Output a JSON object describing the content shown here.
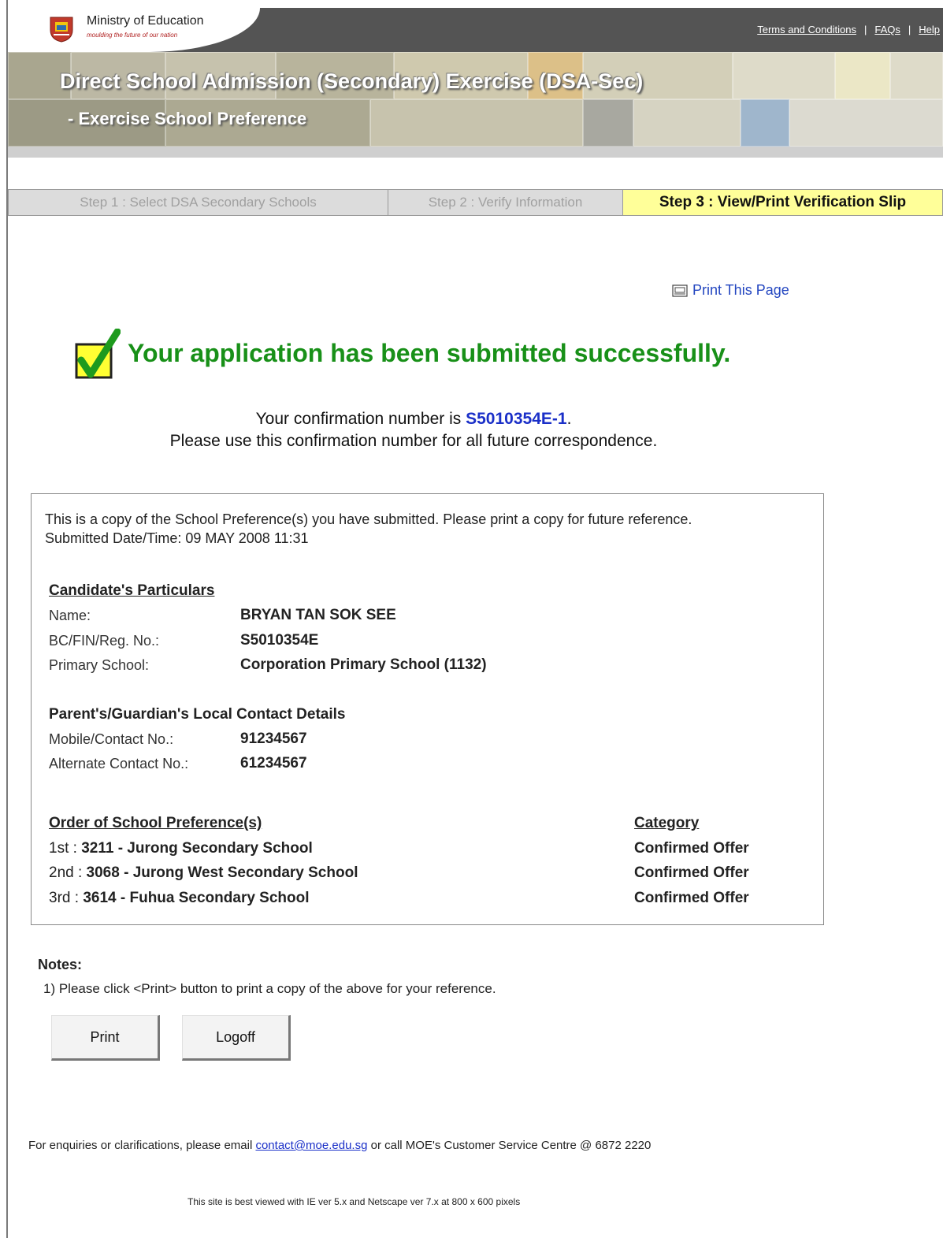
{
  "header": {
    "ministry_title": "Ministry of Education",
    "ministry_tagline": "moulding the future of our nation",
    "links": [
      "Terms and Conditions",
      "FAQs",
      "Help"
    ],
    "link_separator": "|"
  },
  "banner": {
    "title": "Direct School Admission (Secondary) Exercise (DSA-Sec)",
    "subtitle": "- Exercise School Preference"
  },
  "steps": [
    {
      "label": "Step 1 : Select DSA Secondary Schools",
      "active": false
    },
    {
      "label": "Step 2 : Verify Information",
      "active": false
    },
    {
      "label": "Step 3 : View/Print Verification Slip",
      "active": true
    }
  ],
  "print_link": "Print This Page",
  "success_message": "Your application has been submitted successfully.",
  "confirmation": {
    "prefix": "Your confirmation number is ",
    "number": "S5010354E-1",
    "suffix": ".",
    "note": "Please use this confirmation number for all future correspondence."
  },
  "slip": {
    "intro": "This is a copy of the School Preference(s) you have submitted. Please print a copy for future reference.",
    "submitted": "Submitted Date/Time: 09 MAY 2008 11:31",
    "candidate": {
      "title": "Candidate's Particulars",
      "rows": [
        {
          "label": "Name:",
          "value": "BRYAN TAN SOK SEE"
        },
        {
          "label": "BC/FIN/Reg. No.:",
          "value": "S5010354E"
        },
        {
          "label": "Primary School:",
          "value": "Corporation Primary School (1132)"
        }
      ]
    },
    "contact": {
      "title": "Parent's/Guardian's Local Contact Details",
      "rows": [
        {
          "label": "Mobile/Contact No.:",
          "value": "91234567"
        },
        {
          "label": "Alternate Contact No.:",
          "value": "61234567"
        }
      ]
    },
    "preferences": {
      "title": "Order of School Preference(s)",
      "category_title": "Category",
      "rows": [
        {
          "order": "1st : ",
          "code": "3211",
          "school": " - Jurong Secondary School",
          "category": "Confirmed Offer"
        },
        {
          "order": "2nd : ",
          "code": "3068",
          "school": " - Jurong West Secondary School",
          "category": "Confirmed Offer"
        },
        {
          "order": "3rd : ",
          "code": "3614",
          "school": " - Fuhua Secondary School",
          "category": "Confirmed Offer"
        }
      ]
    }
  },
  "notes": {
    "title": "Notes:",
    "items": [
      "1) Please click <Print> button to print a copy of the above for your reference."
    ]
  },
  "buttons": {
    "print": "Print",
    "logoff": "Logoff"
  },
  "footer": {
    "enquiry_prefix": "For enquiries or clarifications, please email ",
    "email": "contact@moe.edu.sg",
    "enquiry_suffix": " or call MOE's Customer Service Centre @  6872 2220",
    "best_viewed": "This site is best viewed with IE ver 5.x and Netscape ver 7.x at 800 x 600 pixels"
  },
  "colors": {
    "success_green": "#189018",
    "confirmation_blue": "#1a2fc8",
    "active_step_yellow": "#ffff99",
    "header_gray": "#545454"
  }
}
